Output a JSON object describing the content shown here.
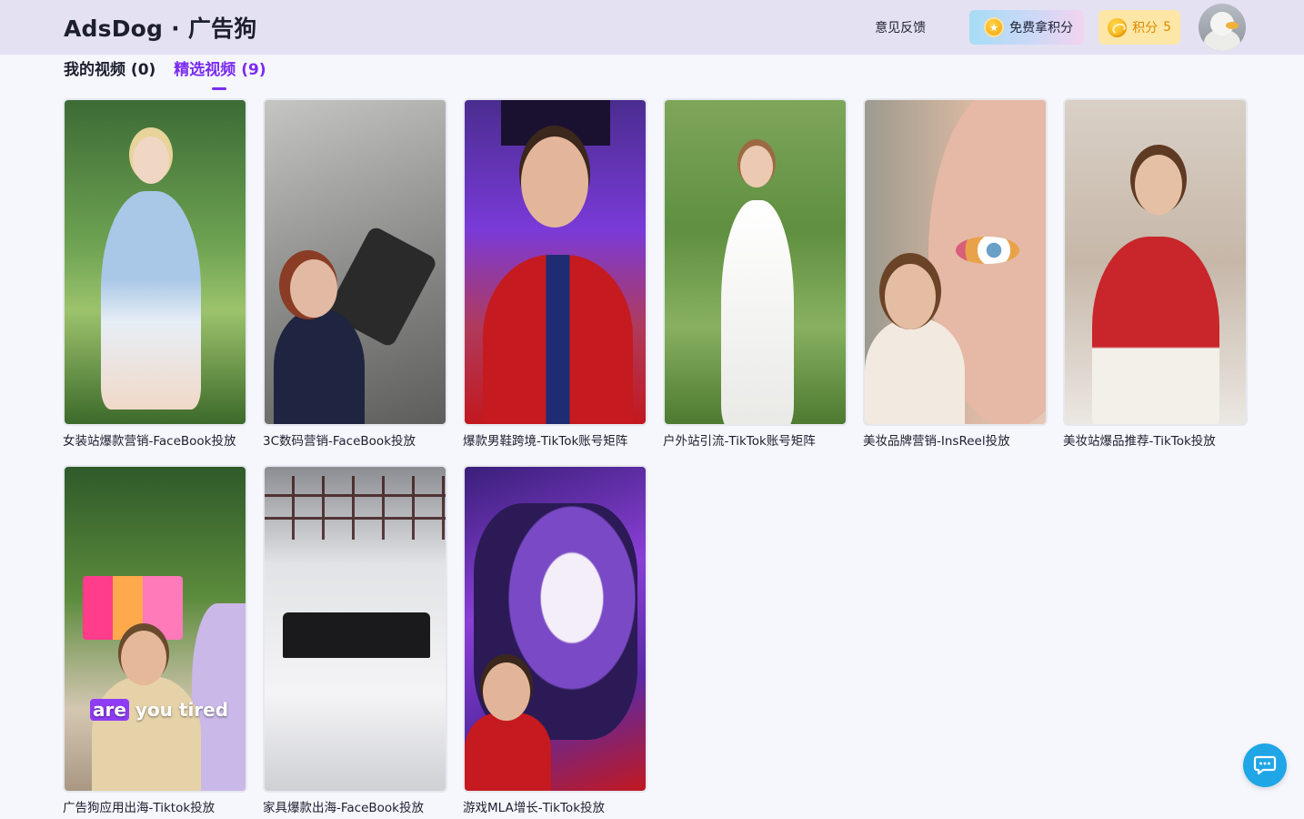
{
  "header": {
    "brand_en": "AdsDog",
    "brand_sep": "·",
    "brand_cn": "广告狗",
    "feedback_label": "意见反馈",
    "free_points_label": "免费拿积分",
    "points_label": "积分",
    "points_value": "5"
  },
  "tabs": [
    {
      "label": "我的视频 (0)",
      "active": false
    },
    {
      "label": "精选视频 (9)",
      "active": true
    }
  ],
  "videos": [
    {
      "title": "女装站爆款营销-FaceBook投放"
    },
    {
      "title": "3C数码营销-FaceBook投放"
    },
    {
      "title": "爆款男鞋跨境-TikTok账号矩阵"
    },
    {
      "title": "户外站引流-TikTok账号矩阵"
    },
    {
      "title": "美妆品牌营销-InsReel投放"
    },
    {
      "title": "美妆站爆品推荐-TikTok投放"
    },
    {
      "title": "广告狗应用出海-Tiktok投放",
      "subtitle": {
        "highlight": "are",
        "rest": "you tired"
      }
    },
    {
      "title": "家具爆款出海-FaceBook投放"
    },
    {
      "title": "游戏MLA增长-TikTok投放"
    }
  ],
  "colors": {
    "accent": "#7b2cf0",
    "header_bg": "#e4e1f3",
    "points_bg": "#fde7a6",
    "points_text": "#e08a00",
    "chat_button": "#1fa6e6"
  },
  "icons": {
    "free_points": "star-coin-icon",
    "points": "coin-icon",
    "chat": "chat-bubble-icon"
  }
}
